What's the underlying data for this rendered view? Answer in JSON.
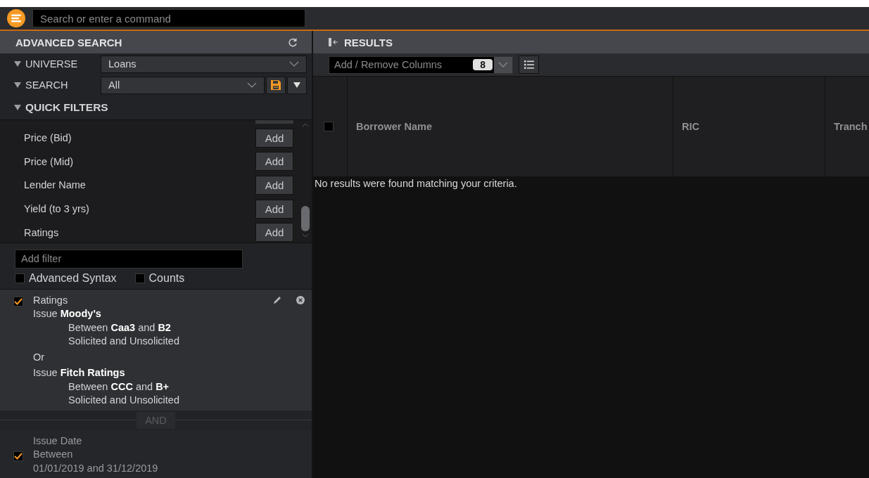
{
  "command_bar": {
    "placeholder": "Search or enter a command"
  },
  "advanced_search": {
    "title": "ADVANCED SEARCH",
    "universe": {
      "label": "UNIVERSE",
      "value": "Loans"
    },
    "search": {
      "label": "SEARCH",
      "value": "All"
    },
    "quick_filters": {
      "title": "QUICK FILTERS",
      "items": [
        {
          "label": "Price (Bid)",
          "button": "Add"
        },
        {
          "label": "Price (Mid)",
          "button": "Add"
        },
        {
          "label": "Lender Name",
          "button": "Add"
        },
        {
          "label": "Yield (to 3 yrs)",
          "button": "Add"
        },
        {
          "label": "Ratings",
          "button": "Add"
        }
      ]
    },
    "filter_input": {
      "placeholder": "Add filter"
    },
    "options": [
      {
        "label": "Advanced Syntax",
        "checked": false
      },
      {
        "label": "Counts",
        "checked": false
      }
    ],
    "filters": [
      {
        "checked": true,
        "title": "Ratings",
        "editable": true,
        "lines": [
          {
            "kind": "source",
            "text": "Issue  **Moody's**"
          },
          {
            "kind": "detail",
            "text": "Between  **Caa3**   and  **B2**"
          },
          {
            "kind": "detail",
            "text": "Solicited and Unsolicited"
          },
          {
            "kind": "or",
            "text": "Or"
          },
          {
            "kind": "source",
            "text": "Issue  **Fitch Ratings**"
          },
          {
            "kind": "detail",
            "text": "Between  **CCC**   and  **B+**"
          },
          {
            "kind": "detail",
            "text": "Solicited and Unsolicited"
          }
        ]
      },
      {
        "checked": true,
        "title": "Issue Date",
        "editable": false,
        "lines": [
          {
            "kind": "plain",
            "text": "Between"
          },
          {
            "kind": "plain",
            "text": "01/01/2019 and 31/12/2019"
          }
        ]
      }
    ],
    "connector": "AND"
  },
  "results": {
    "title": "RESULTS",
    "columns_picker": {
      "label": "Add / Remove Columns",
      "count": "8"
    },
    "select_all": {
      "checked": false
    },
    "columns": [
      "Borrower Name",
      "RIC",
      "Tranch"
    ],
    "message": "No results were found matching your criteria."
  }
}
